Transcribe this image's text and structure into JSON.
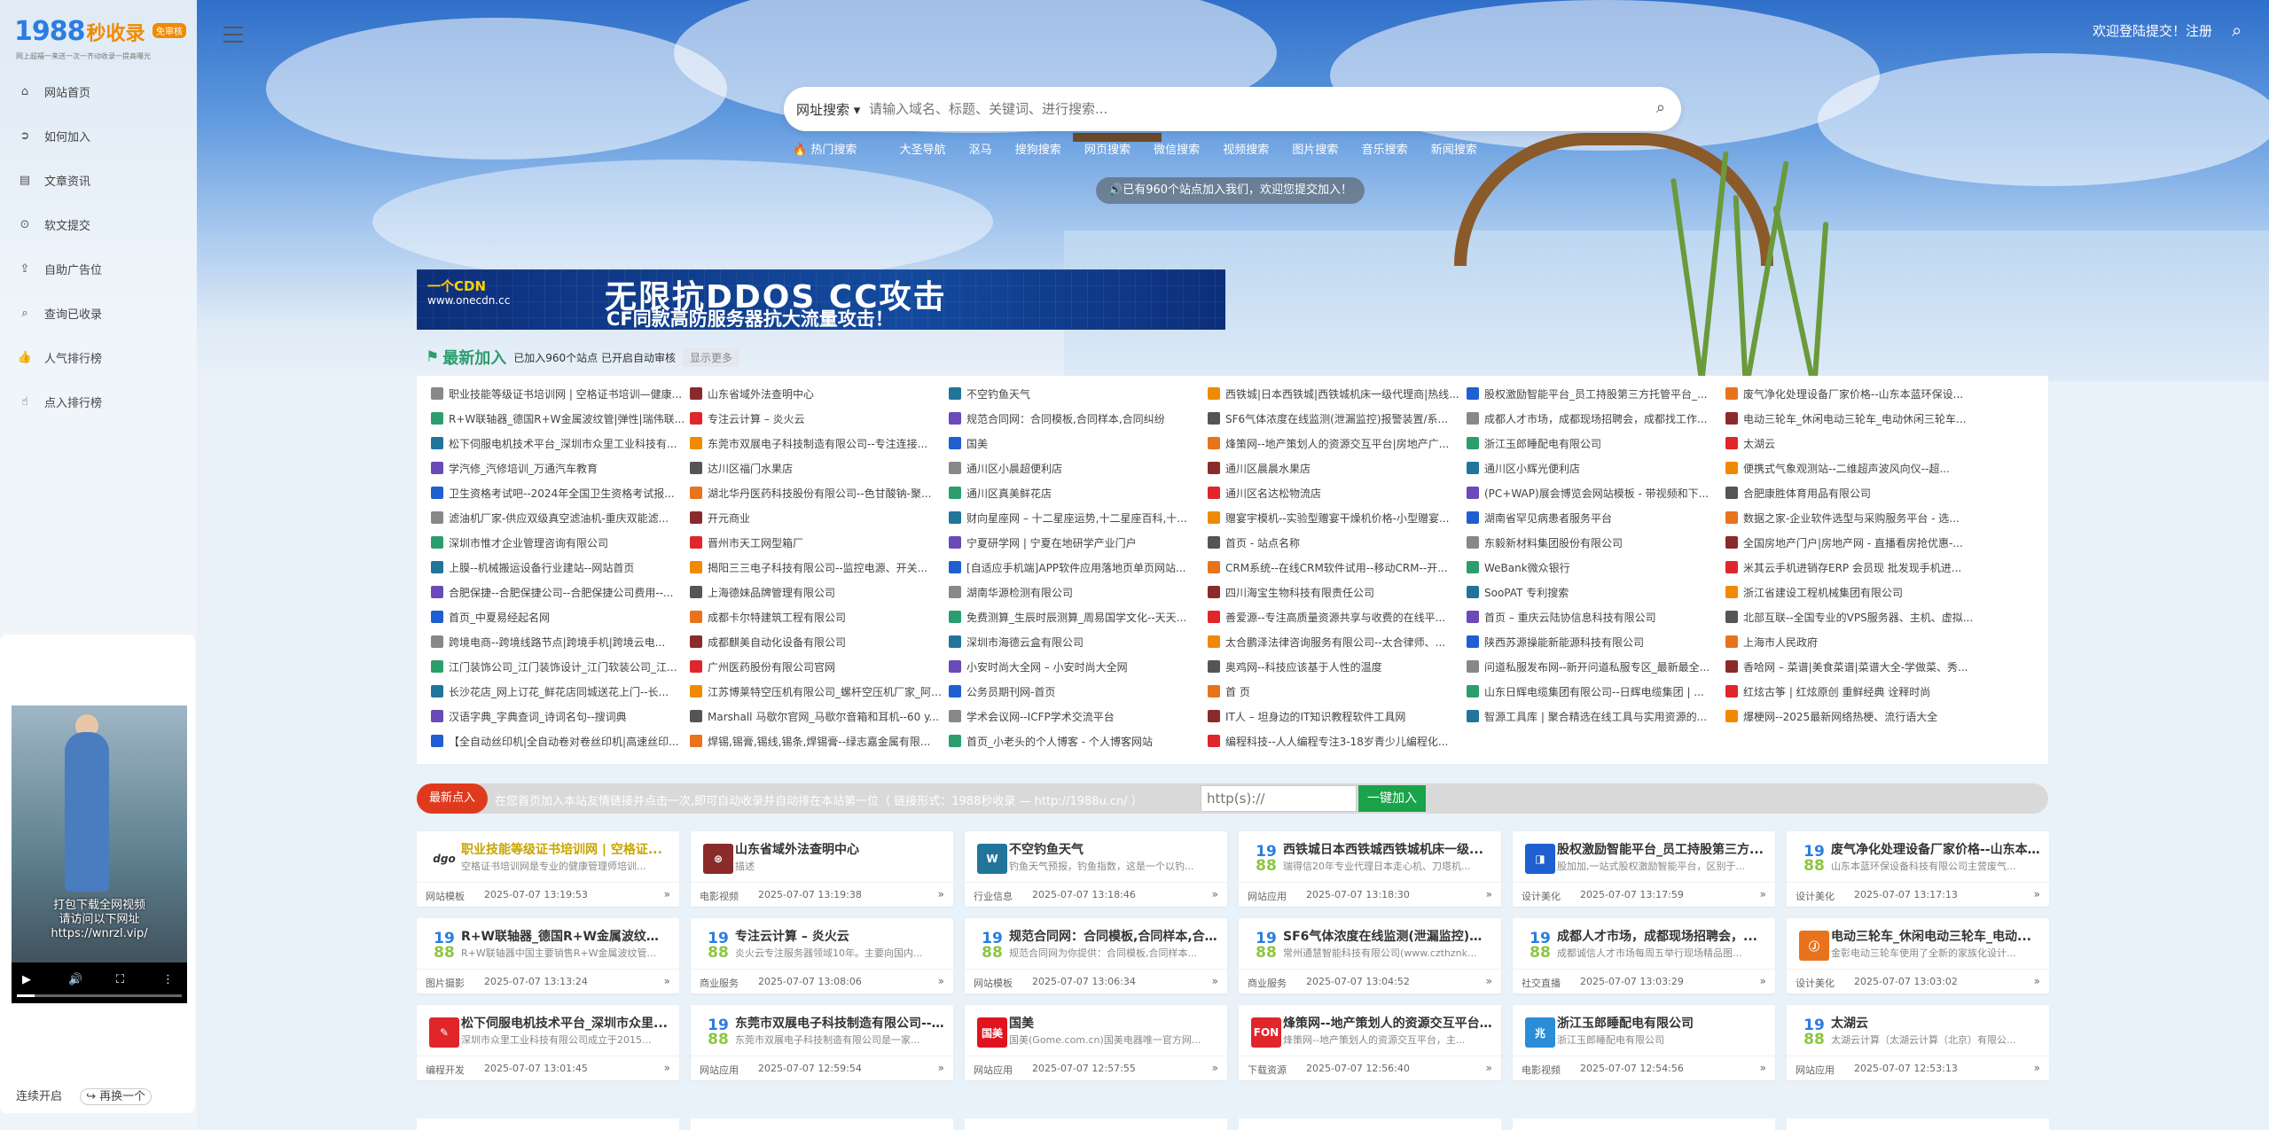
{
  "logo": {
    "number": "1988",
    "name": "秒收录",
    "badge": "免审核",
    "slogan": "网上超福一来送一次一齐动收录一提高曝光"
  },
  "nav": [
    {
      "label": "网站首页",
      "icon": "home-icon",
      "glyph": "⌂"
    },
    {
      "label": "如何加入",
      "icon": "arrow-circle-icon",
      "glyph": "➲"
    },
    {
      "label": "文章资讯",
      "icon": "book-icon",
      "glyph": "▤"
    },
    {
      "label": "软文提交",
      "icon": "upload-circle-icon",
      "glyph": "⊙"
    },
    {
      "label": "自助广告位",
      "icon": "upload-icon",
      "glyph": "⇪"
    },
    {
      "label": "查询已收录",
      "icon": "search-icon",
      "glyph": "⌕"
    },
    {
      "label": "人气排行榜",
      "icon": "thumbs-up-icon",
      "glyph": "👍"
    },
    {
      "label": "点入排行榜",
      "icon": "pointer-icon",
      "glyph": "☝"
    }
  ],
  "topbar": {
    "login_text": "欢迎登陆提交！注册"
  },
  "search": {
    "select": "网址搜索",
    "placeholder": "请输入域名、标题、关键词、进行搜索..."
  },
  "engines": [
    "热门搜索",
    "大圣导航",
    "沤马",
    "搜狗搜索",
    "网页搜索",
    "微信搜索",
    "视频搜索",
    "图片搜索",
    "音乐搜索",
    "新闻搜索"
  ],
  "notice": "已有960个站点加入我们，欢迎您提交加入！",
  "ad": {
    "brand": "一个CDN",
    "brand_url": "www.onecdn.cc",
    "headline": "无限抗DDOS CC攻击",
    "subline": "CF同款高防服务器抗大流量攻击！"
  },
  "newest": {
    "title": "最新加入",
    "stats": "已加入960个站点 已开启自动审核",
    "more": "显示更多"
  },
  "links": [
    "职业技能等级证书培训网 | 空格证书培训—健康...",
    "山东省域外法查明中心",
    "不空钓鱼天气",
    "西铁城|日本西铁城|西铁城机床一级代理商|热线...",
    "股权激励智能平台_员工持股第三方托管平台_...",
    "废气净化处理设备厂家价格--山东本蓝环保设...",
    "R+W联轴器_德国R+W金属波纹管|弹性|瑞伟联...",
    "专注云计算 – 炎火云",
    "规范合同网：合同模板,合同样本,合同纠纷",
    "SF6气体浓度在线监测(泄漏监控)报警装置/系...",
    "成都人才市场，成都现场招聘会，成都找工作...",
    "电动三轮车_休闲电动三轮车_电动休闲三轮车...",
    "松下伺服电机技术平台_深圳市众里工业科技有...",
    "东莞市双展电子科技制造有限公司--专注连接...",
    "国美",
    "烽策网--地产策划人的资源交互平台|房地产广...",
    "浙江玉郎睡配电有限公司",
    "太湖云",
    "学汽修_汽修培训_万通汽车教育",
    "达川区福门水果店",
    "通川区小晨超便利店",
    "通川区晨晨水果店",
    "通川区小辉光便利店",
    "便携式气象观测站--二维超声波风向仪--超...",
    "卫生资格考试吧--2024年全国卫生资格考试报...",
    "湖北华丹医药科技股份有限公司--色甘酸钠-聚...",
    "通川区真美鲜花店",
    "通川区名达松物流店",
    "(PC+WAP)展会博览会网站模板 - 带视频和下...",
    "合肥康胜体育用品有限公司",
    "滤油机厂家-供应双级真空滤油机-重庆双能滤...",
    "开元商业",
    "财向星座网 – 十二星座运势,十二星座百科,十...",
    "赠宴宇模机--实验型赠宴干燥机价格-小型赠宴...",
    "湖南省罕见病患者服务平台",
    "数据之家-企业软件选型与采购服务平台 - 选...",
    "深圳市惟才企业管理咨询有限公司",
    "晋州市天工网型箱厂",
    "宁夏研学网 | 宁夏在地研学产业门户",
    "首页 - 站点名称",
    "东毅新材料集团股份有限公司",
    "全国房地产门户|房地产网 - 直播看房抢优惠-...",
    "上膜--机械搬运设备行业建站--网站首页",
    "揭阳三三电子科技有限公司--监控电源、开关...",
    "[自适应手机端]APP软件应用落地页单页网站...",
    "CRM系统--在线CRM软件试用--移动CRM--开...",
    "WeBank微众银行",
    "米其云手机进销存ERP 会员现 批发现手机进...",
    "合肥保捷--合肥保捷公司--合肥保捷公司费用--...",
    "上海德妹品牌管理有限公司",
    "湖南华源检测有限公司",
    "四川海宝生物科技有限责任公司",
    "SooPAT 专利搜索",
    "浙江省建设工程机械集团有限公司",
    "首页_中夏易经起名网",
    "成都卡尔特建筑工程有限公司",
    "免费测算_生辰时辰测算_周易国学文化--天天...",
    "善爱源--专注高质量资源共享与收费的在线平...",
    "首页 – 重庆云陆协信息科技有限公司",
    "北部互联--全国专业的VPS服务器、主机、虚拟...",
    "跨境电商--跨境线路节点|跨境手机|跨境云电...",
    "成都麒美自动化设备有限公司",
    "深圳市海德云盒有限公司",
    "太合鹏泽法律咨询服务有限公司--太合律师、...",
    "陕西苏源操能新能源科技有限公司",
    "上海市人民政府",
    "江门装饰公司_江门装饰设计_江门软装公司_江...",
    "广州医药股份有限公司官网",
    "小安时尚大全网 – 小安时尚大全网",
    "奥鸡网--科技应该基于人性的温度",
    "问道私服发布网--新开问道私服专区_最新最全...",
    "香哈网 – 菜谱|美食菜谱|菜谱大全-学做菜、秀...",
    "长沙花店_网上订花_鲜花店同城送花上门--长...",
    "江苏博莱特空压机有限公司_螺杆空压机厂家_阿特...",
    "公务员期刊网-首页",
    "首 页",
    "山东日辉电缆集团有限公司--日辉电缆集团 | ...",
    "红炫古筝 | 红炫原创 重鲜经典 诠释时尚",
    "汉语字典_字典查词_诗词名句--搜词典",
    "Marshall 马歇尔官网_马歇尔音箱和耳机--60 y...",
    "学术会议网--ICFP学术交流平台",
    "IT人 – 坦身边的IT知识教程软件工具网",
    "智源工具库 | 聚合精选在线工具与实用资源的...",
    "爆梗网--2025最新网络热梗、流行语大全",
    "【全自动丝印机|全自动卷对卷丝印机|高速丝印...",
    "焊锡,锡膏,锡线,锡条,焊锡膏--绿志嘉金属有限...",
    "首页_小老头的个人博客 - 个人博客网站",
    "编程科技--人人编程专注3-18岁青少儿编程化..."
  ],
  "submit": {
    "label": "最新点入",
    "desc": "在您首页加入本站友情链接并点击一次,即可自动收录并自动排在本站第一位（ 链接形式：1988秒收录 — http://1988u.cn/ ）",
    "placeholder": "http(s)://",
    "button": "一键加入"
  },
  "cards": [
    {
      "title": "职业技能等级证书培训网 | 空格证...",
      "desc": "空格证书培训网是专业的健康管理师培训...",
      "category": "网站模板",
      "date": "2025-07-07 13:19:53",
      "icon": "text",
      "icon_text": "dgo",
      "color": "#ffffff",
      "highlight": true
    },
    {
      "title": "山东省域外法查明中心",
      "desc": "描述",
      "category": "电影视频",
      "date": "2025-07-07 13:19:38",
      "icon": "seal",
      "icon_text": "⊛",
      "color": "#8b2a2a"
    },
    {
      "title": "不空钓鱼天气",
      "desc": "钓鱼天气预报，钓鱼指数，这是一个以钓...",
      "category": "行业信息",
      "date": "2025-07-07 13:18:46",
      "icon": "wp",
      "icon_text": "W",
      "color": "#21759b"
    },
    {
      "title": "西铁城日本西铁城西铁城机床一级...",
      "desc": "瑞得信20年专业代理日本走心机、刀塔机...",
      "category": "网站应用",
      "date": "2025-07-07 13:18:30",
      "icon": "1988"
    },
    {
      "title": "股权激励智能平台_员工持股第三方...",
      "desc": "股加加,一站式股权激励智能平台，区别于...",
      "category": "设计美化",
      "date": "2025-07-07 13:17:59",
      "icon": "text",
      "icon_text": "◨",
      "color": "#1f5fd1"
    },
    {
      "title": "废气净化处理设备厂家价格--山东本...",
      "desc": "山东本蓝环保设备科技有限公司主营废气...",
      "category": "设计美化",
      "date": "2025-07-07 13:17:13",
      "icon": "1988"
    },
    {
      "title": "R+W联轴器_德国R+W金属波纹管|...",
      "desc": "R+W联轴器中国主要销售R+W金属波纹管...",
      "category": "图片摄影",
      "date": "2025-07-07 13:13:24",
      "icon": "1988"
    },
    {
      "title": "专注云计算 – 炎火云",
      "desc": "炎火云专注服务器领域10年。主要向国内...",
      "category": "商业服务",
      "date": "2025-07-07 13:08:06",
      "icon": "1988"
    },
    {
      "title": "规范合同网：合同模板,合同样本,合...",
      "desc": "规范合同网为你提供：合同模板,合同样本...",
      "category": "网站模板",
      "date": "2025-07-07 13:06:34",
      "icon": "1988"
    },
    {
      "title": "SF6气体浓度在线监测(泄漏监控)报...",
      "desc": "常州通慧智能科技有限公司(www.czthznk...",
      "category": "商业服务",
      "date": "2025-07-07 13:04:52",
      "icon": "1988"
    },
    {
      "title": "成都人才市场，成都现场招聘会，...",
      "desc": "成都诚信人才市场每周五举行现场精品图...",
      "category": "社交直播",
      "date": "2025-07-07 13:03:29",
      "icon": "1988"
    },
    {
      "title": "电动三轮车_休闲电动三轮车_电动...",
      "desc": "金彰电动三轮车使用了全新的家族化设计...",
      "category": "设计美化",
      "date": "2025-07-07 13:03:02",
      "icon": "text",
      "icon_text": "Ⓙ",
      "color": "#e8731c"
    },
    {
      "title": "松下伺服电机技术平台_深圳市众里...",
      "desc": "深圳市众里工业科技有限公司成立于2015...",
      "category": "编程开发",
      "date": "2025-07-07 13:01:45",
      "icon": "text",
      "icon_text": "✎",
      "color": "#e0262b"
    },
    {
      "title": "东莞市双展电子科技制造有限公司--...",
      "desc": "东莞市双展电子科技制造有限公司是一家...",
      "category": "网站应用",
      "date": "2025-07-07 12:59:54",
      "icon": "1988"
    },
    {
      "title": "国美",
      "desc": "国美(Gome.com.cn)国美电器唯一官方网...",
      "category": "网站应用",
      "date": "2025-07-07 12:57:55",
      "icon": "text",
      "icon_text": "国美",
      "color": "#e0141e"
    },
    {
      "title": "烽策网--地产策划人的资源交互平台...",
      "desc": "烽策网--地产策划人的资源交互平台，主...",
      "category": "下载资源",
      "date": "2025-07-07 12:56:40",
      "icon": "text",
      "icon_text": "FON",
      "color": "#e0262b"
    },
    {
      "title": "浙江玉郎睡配电有限公司",
      "desc": "浙江玉郎睡配电有限公司",
      "category": "电影视频",
      "date": "2025-07-07 12:54:56",
      "icon": "text",
      "icon_text": "兆",
      "color": "#2b8cd8"
    },
    {
      "title": "太湖云",
      "desc": "太湖云计算（太湖云计算（北京）有限公...",
      "category": "网站应用",
      "date": "2025-07-07 12:53:13",
      "icon": "1988"
    }
  ]
}
